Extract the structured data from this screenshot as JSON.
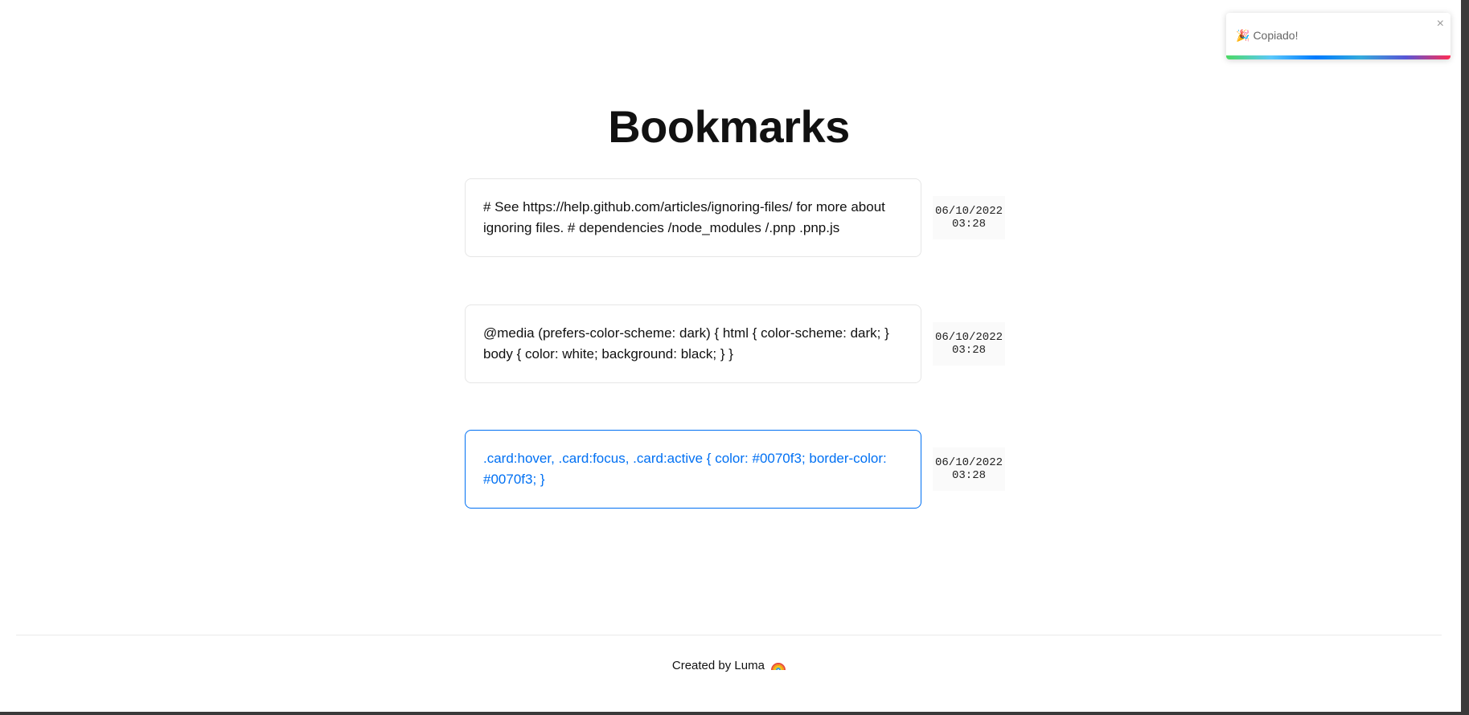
{
  "page": {
    "title": "Bookmarks"
  },
  "bookmarks": [
    {
      "text": "# See https://help.github.com/articles/ignoring-files/ for more about ignoring files. # dependencies /node_modules /.pnp .pnp.js",
      "date": "06/10/2022",
      "time": "03:28",
      "active": false
    },
    {
      "text": "@media (prefers-color-scheme: dark) { html { color-scheme: dark; } body { color: white; background: black; } }",
      "date": "06/10/2022",
      "time": "03:28",
      "active": false
    },
    {
      "text": ".card:hover, .card:focus, .card:active { color: #0070f3; border-color: #0070f3; }",
      "date": "06/10/2022",
      "time": "03:28",
      "active": true
    }
  ],
  "footer": {
    "text": "Created by Luma",
    "icon": "rainbow-icon"
  },
  "toast": {
    "icon": "🎉",
    "message": "Copiado!",
    "close_label": "×"
  },
  "colors": {
    "accent": "#0070f3",
    "text": "#111111",
    "border": "#e6e6e6"
  }
}
